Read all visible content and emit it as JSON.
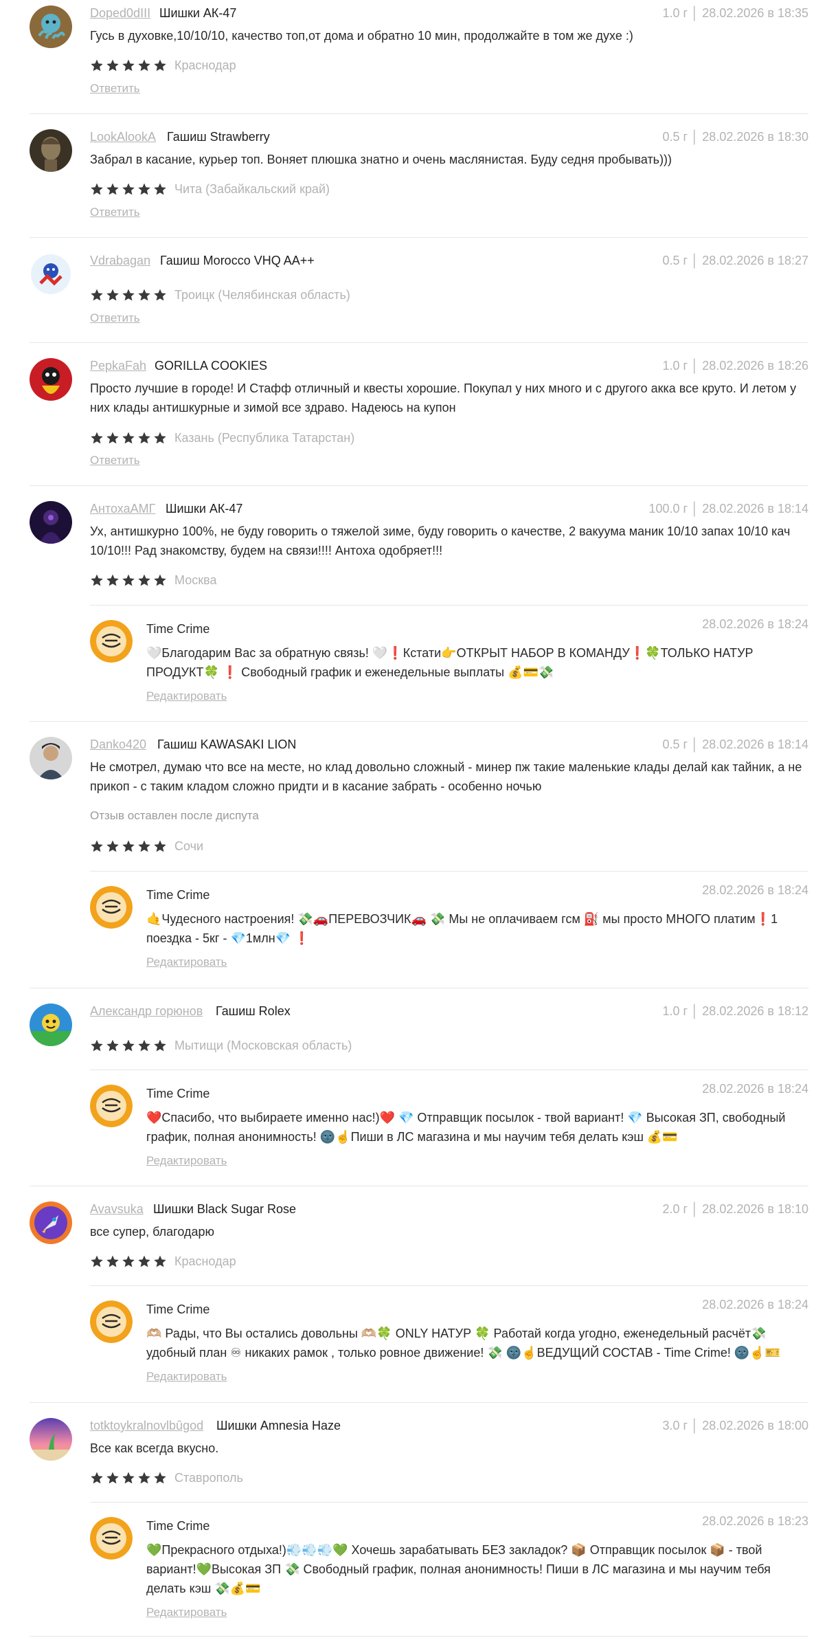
{
  "reviews": [
    {
      "author": "Doped0dIII",
      "product": "Шишки АК-47",
      "meta": "1.0 г │ 28.02.2026 в 18:35",
      "text": "Гусь в духовке,10/10/10, качество топ,от дома и обратно 10 мин, продолжайте в том же духе :)",
      "rating": 5,
      "city": "Краснодар",
      "reply_link": "Ответить"
    },
    {
      "author": "LookAlookA",
      "product": "Гашиш Strawberry",
      "meta": "0.5 г │ 28.02.2026 в 18:30",
      "text": "Забрал в касание, курьер топ. Воняет плюшка знатно и очень маслянистая. Буду седня пробывать)))",
      "rating": 5,
      "city": "Чита (Забайкальский край)",
      "reply_link": "Ответить"
    },
    {
      "author": "Vdrabagan",
      "product": "Гашиш Morocco VHQ AA++",
      "meta": "0.5 г │ 28.02.2026 в 18:27",
      "text": "",
      "rating": 5,
      "city": "Троицк (Челябинская область)",
      "reply_link": "Ответить"
    },
    {
      "author": "PepkaFah",
      "product": "GORILLA COOKIES",
      "meta": "1.0 г │ 28.02.2026 в 18:26",
      "text": "Просто лучшие в городе! И Стафф отличный и квесты хорошие. Покупал у них много и с другого акка все круто. И летом у них клады антишкурные и зимой все здраво. Надеюсь на купон",
      "rating": 5,
      "city": "Казань (Республика Татарстан)",
      "reply_link": "Ответить"
    },
    {
      "author": "АнтохаАМГ",
      "product": "Шишки АК-47",
      "meta": "100.0 г │ 28.02.2026 в 18:14",
      "text": "Ух, антишкурно 100%, не буду говорить о тяжелой зиме, буду говорить о качестве, 2 вакуума маник 10/10 запах 10/10 кач 10/10!!! Рад знакомству, будем на связи!!!! Антоха одобряет!!!",
      "rating": 5,
      "city": "Москва",
      "reply": {
        "name": "Time Crime",
        "date": "28.02.2026 в 18:24",
        "text": "🤍Благодарим Вас за обратную связь! 🤍❗Кстати👉ОТКРЫТ НАБОР В КОМАНДУ❗🍀ТОЛЬКО НАТУР ПРОДУКТ🍀 ❗ Свободный график и еженедельные выплаты 💰💳💸",
        "edit_link": "Редактировать"
      }
    },
    {
      "author": "Danko420",
      "product": "Гашиш KAWASAKI LION",
      "meta": "0.5 г │ 28.02.2026 в 18:14",
      "text": "Не смотрел, думаю что все на месте, но клад довольно сложный - минер пж такие маленькие клады делай как тайник, а не прикоп - с таким кладом сложно придти и в касание забрать - особенно ночью",
      "note": "Отзыв оставлен после диспута",
      "rating": 5,
      "city": "Сочи",
      "reply": {
        "name": "Time Crime",
        "date": "28.02.2026 в 18:24",
        "text": "🤙Чудесного настроения! 💸🚗ПЕРЕВОЗЧИК🚗 💸 Мы не оплачиваем гсм ⛽ мы просто МНОГО платим❗1 поездка - 5кг - 💎1млн💎 ❗",
        "edit_link": "Редактировать"
      }
    },
    {
      "author": "Александр горюнов",
      "product": "Гашиш Rolex",
      "meta": "1.0 г │ 28.02.2026 в 18:12",
      "text": "",
      "rating": 5,
      "city": "Мытищи (Московская область)",
      "reply": {
        "name": "Time Crime",
        "date": "28.02.2026 в 18:24",
        "text": "❤️Спасибо, что выбираете именно нас!)❤️ 💎 Отправщик посылок - твой вариант! 💎 Высокая ЗП, свободный график, полная анонимность! 🌚☝️Пиши в ЛС магазина и мы научим тебя делать кэш 💰💳",
        "edit_link": "Редактировать"
      }
    },
    {
      "author": "Avavsuka",
      "product": "Шишки Black Sugar Rose",
      "meta": "2.0 г │ 28.02.2026 в 18:10",
      "text": "все супер, благодарю",
      "rating": 5,
      "city": "Краснодар",
      "reply": {
        "name": "Time Crime",
        "date": "28.02.2026 в 18:24",
        "text": "🫶🏼 Рады, что Вы остались довольны 🫶🏼🍀 ONLY НАТУР 🍀 Работай когда угодно, еженедельный расчёт💸 удобный план ♾ никаких рамок , только ровное движение! 💸 🌚☝️ВЕДУЩИЙ СОСТАВ - Time Crime! 🌚☝️🎫",
        "edit_link": "Редактировать"
      }
    },
    {
      "author": "totktoykralnovlbûgod",
      "product": "Шишки Amnesia Haze",
      "meta": "3.0 г │ 28.02.2026 в 18:00",
      "text": "Все как всегда вкусно.",
      "rating": 5,
      "city": "Ставрополь",
      "reply": {
        "name": "Time Crime",
        "date": "28.02.2026 в 18:23",
        "text": "💚Прекрасного отдыха!)💨💨💨💚 Хочешь зарабатывать БЕЗ закладок? 📦 Отправщик посылок 📦 - твой вариант!💚Высокая ЗП 💸 Свободный график, полная анонимность! Пиши в ЛС магазина и мы научим тебя делать кэш 💸💰💳",
        "edit_link": "Редактировать"
      }
    }
  ],
  "colors": {
    "star": "#3a3a3a",
    "muted": "#b3b3b3",
    "text": "#2a2a2a",
    "divider": "#e6e6e6",
    "reply_avatar": "#f2a21b"
  }
}
